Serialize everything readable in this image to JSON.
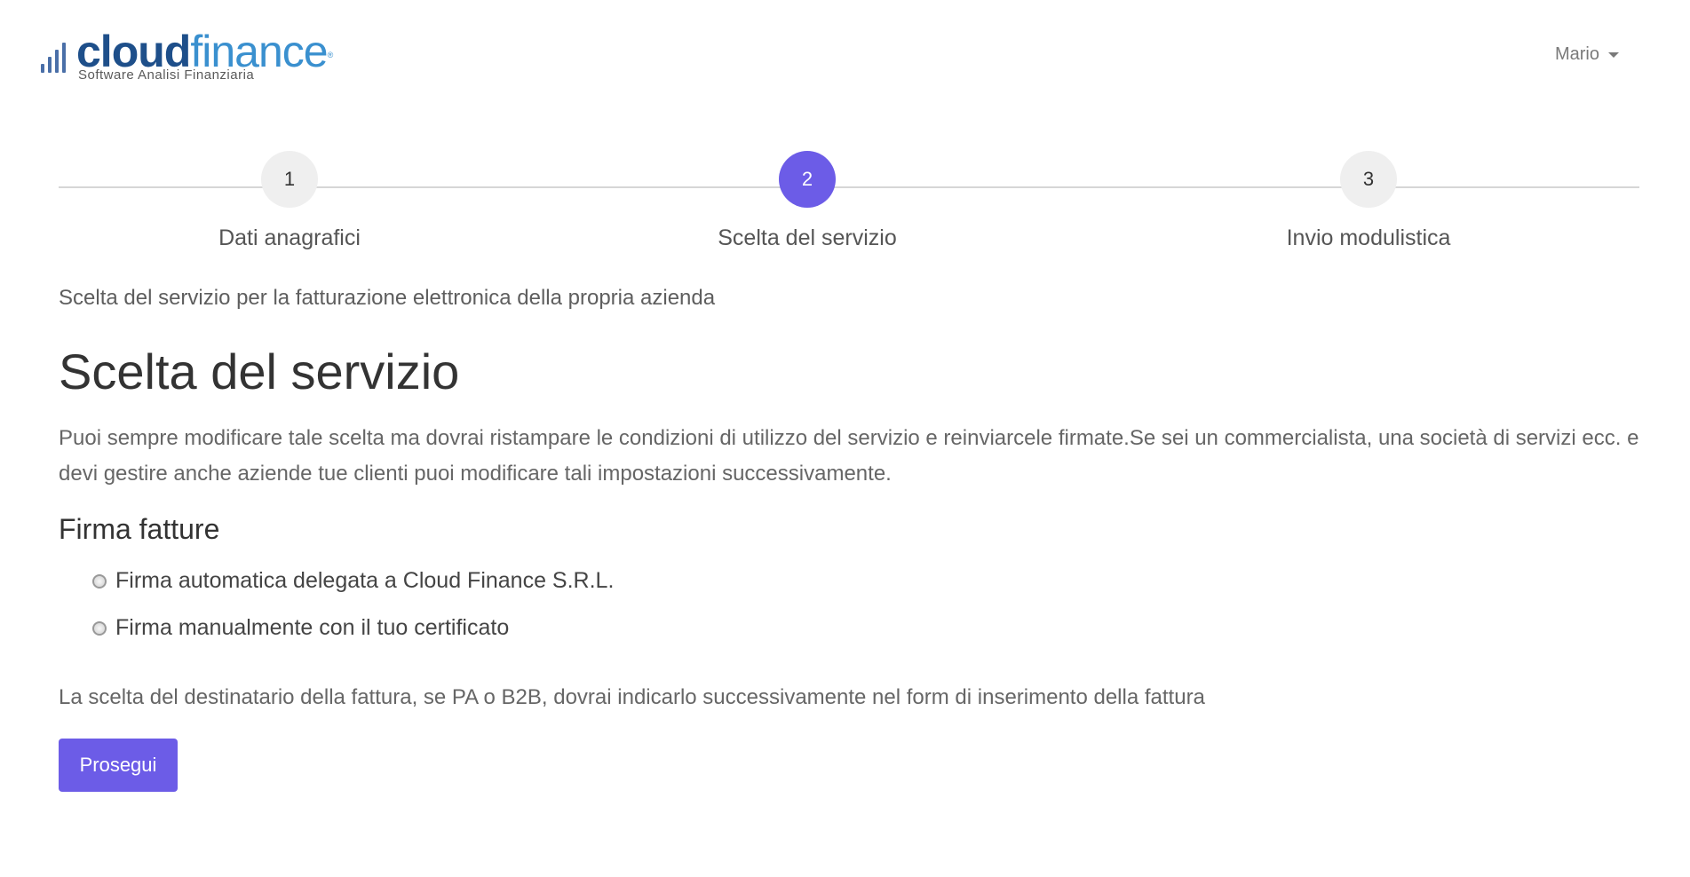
{
  "header": {
    "logo_cloud": "cloud",
    "logo_finance": "finance",
    "logo_reg": "®",
    "logo_tagline": "Software Analisi Finanziaria",
    "user_name": "Mario"
  },
  "stepper": {
    "steps": [
      {
        "number": "1",
        "label": "Dati anagrafici",
        "active": false
      },
      {
        "number": "2",
        "label": "Scelta del servizio",
        "active": true
      },
      {
        "number": "3",
        "label": "Invio modulistica",
        "active": false
      }
    ]
  },
  "intro_text": "Scelta del servizio per la fatturazione elettronica della propria azienda",
  "title": "Scelta del servizio",
  "description": "Puoi sempre modificare tale scelta ma dovrai ristampare le condizioni di utilizzo del servizio e reinviarcele firmate.Se sei un commercialista, una società di servizi ecc. e devi gestire anche aziende tue clienti puoi modificare tali impostazioni successivamente.",
  "firma_section": {
    "title": "Firma fatture",
    "options": [
      {
        "label": "Firma automatica delegata a Cloud Finance S.R.L.",
        "checked": false
      },
      {
        "label": "Firma manualmente con il tuo certificato",
        "checked": false
      }
    ]
  },
  "note": "La scelta del destinatario della fattura, se PA o B2B, dovrai indicarlo successivamente nel form di inserimento della fattura",
  "continue_button": "Prosegui",
  "colors": {
    "accent": "#6c5ce7",
    "logo_dark": "#1e4f8a",
    "logo_light": "#3a90cf"
  }
}
